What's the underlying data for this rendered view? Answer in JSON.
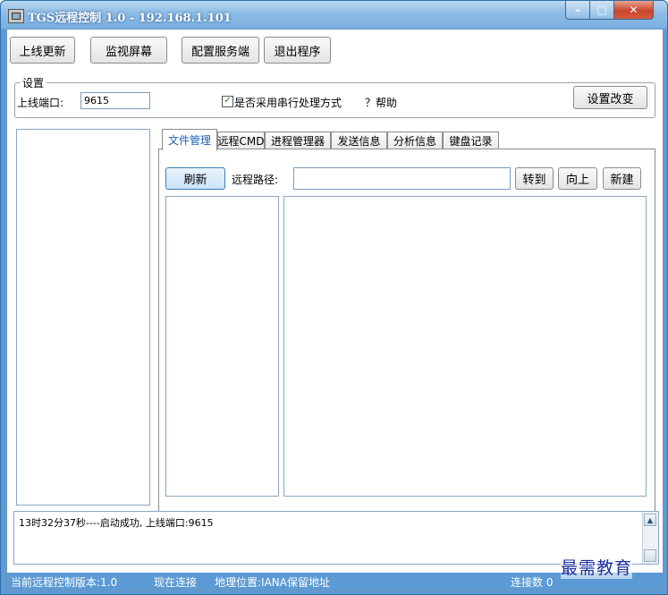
{
  "window": {
    "title": "TGS远程控制 1.0 - 192.168.1.101"
  },
  "toolbar": {
    "update_label": "上线更新",
    "monitor_label": "监视屏幕",
    "config_label": "配置服务端",
    "exit_label": "退出程序"
  },
  "settings": {
    "group_label": "设置",
    "port_label": "上线端口:",
    "port_value": "9615",
    "serial_checkbox_label": "是否采用串行处理方式",
    "serial_checked": true,
    "help_label": "？帮助",
    "apply_label": "设置改变"
  },
  "tabs": [
    {
      "label": "文件管理",
      "active": true
    },
    {
      "label": "远程CMD",
      "active": false
    },
    {
      "label": "进程管理器",
      "active": false
    },
    {
      "label": "发送信息",
      "active": false
    },
    {
      "label": "分析信息",
      "active": false
    },
    {
      "label": "键盘记录",
      "active": false
    }
  ],
  "file_manager": {
    "refresh_label": "刷新",
    "path_label": "远程路径:",
    "path_value": "",
    "goto_label": "转到",
    "up_label": "向上",
    "new_label": "新建"
  },
  "log": {
    "line": "13时32分37秒----启动成功, 上线端口:9615"
  },
  "status": {
    "version": "当前远程控制版本:1.0",
    "current_connection": "现在连接",
    "location": "地理位置:IANA保留地址",
    "connection_count": "连接数 0"
  },
  "watermark": {
    "text": "最需教育"
  }
}
